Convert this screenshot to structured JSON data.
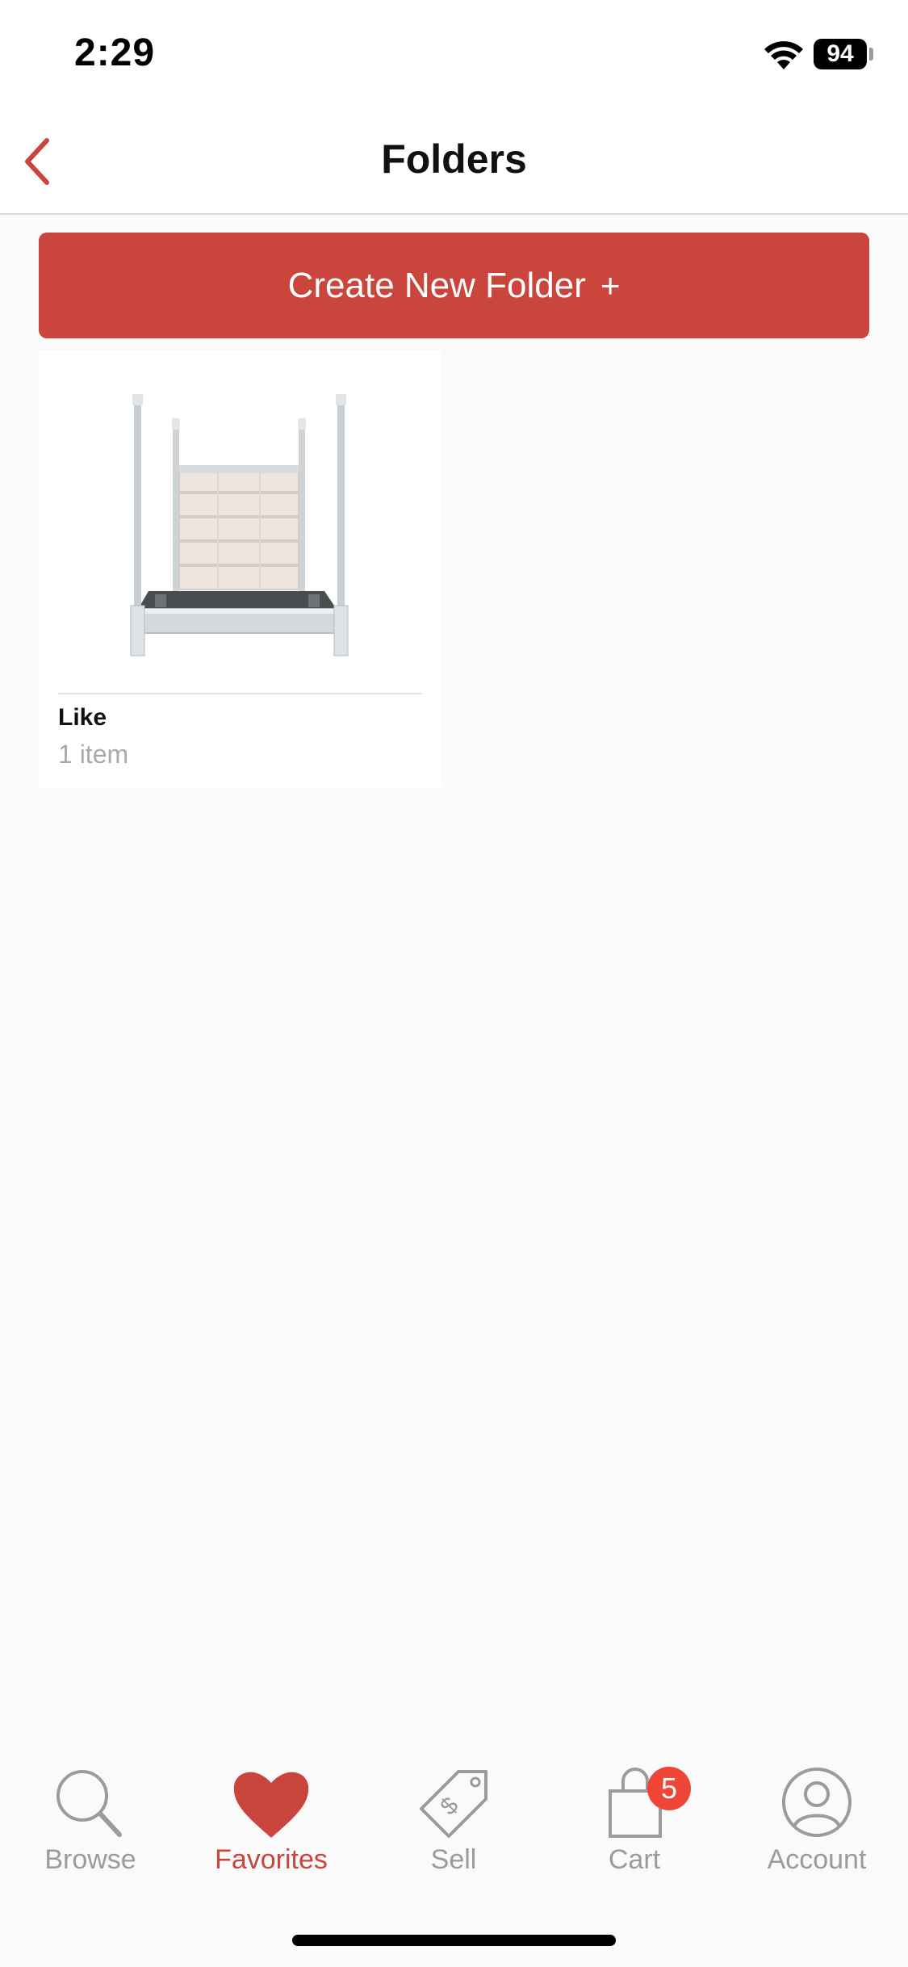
{
  "status_bar": {
    "time": "2:29",
    "battery": "94",
    "icons": [
      "wifi-icon",
      "battery-icon"
    ]
  },
  "nav": {
    "title": "Folders",
    "back_icon": "chevron-left-icon"
  },
  "actions": {
    "create_folder_label": "Create New Folder",
    "create_folder_plus": "+"
  },
  "folders": [
    {
      "name": "Like",
      "count": "1 item",
      "thumbnail": "four-poster-bed-image"
    }
  ],
  "tab_bar": {
    "tabs": [
      {
        "label": "Browse",
        "icon": "search-icon",
        "active": false
      },
      {
        "label": "Favorites",
        "icon": "heart-icon",
        "active": true
      },
      {
        "label": "Sell",
        "icon": "price-tag-icon",
        "active": false
      },
      {
        "label": "Cart",
        "icon": "shopping-bag-icon",
        "active": false,
        "badge": "5"
      },
      {
        "label": "Account",
        "icon": "user-icon",
        "active": false
      }
    ]
  },
  "colors": {
    "accent": "#ca463c",
    "badge": "#f04638",
    "inactive": "#9b9b9b",
    "background": "#fafafa"
  }
}
